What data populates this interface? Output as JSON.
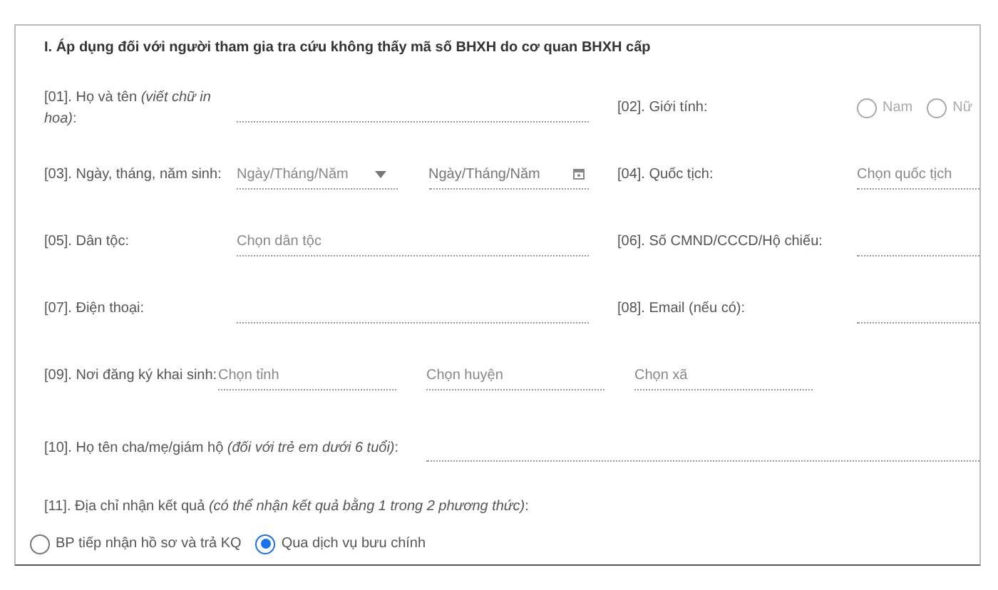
{
  "section_title": "I. Áp dụng đối với người tham gia tra cứu không thấy mã số BHXH do cơ quan BHXH cấp",
  "rows": [
    {
      "kind": "pair",
      "left": {
        "label": "[01]. Họ và tên *(viết chữ in hoa)*:",
        "control": {
          "kind": "text"
        }
      },
      "right": {
        "label": "[02]. Giới tính:",
        "control": {
          "kind": "radios",
          "options": [
            {
              "label": "Nam",
              "selected": false
            },
            {
              "label": "Nữ",
              "selected": false
            }
          ]
        }
      }
    },
    {
      "kind": "pair",
      "left": {
        "label": "[03]. Ngày, tháng, năm sinh:",
        "control": {
          "kind": "split",
          "controls": [
            {
              "kind": "select",
              "placeholder": "Ngày/Tháng/Năm",
              "caret": true
            },
            {
              "kind": "date",
              "placeholder": "Ngày/Tháng/Năm"
            }
          ]
        }
      },
      "right": {
        "label": "[04]. Quốc tịch:",
        "control": {
          "kind": "select",
          "placeholder": "Chọn quốc tịch",
          "caret": false
        }
      }
    },
    {
      "kind": "pair",
      "left": {
        "label": "[05]. Dân tộc:",
        "control": {
          "kind": "select",
          "placeholder": "Chọn dân tộc",
          "caret": false
        }
      },
      "right": {
        "label": "[06]. Số CMND/CCCD/Hộ chiếu:",
        "control": {
          "kind": "text"
        }
      }
    },
    {
      "kind": "pair",
      "left": {
        "label": "[07]. Điện thoại:",
        "control": {
          "kind": "text"
        }
      },
      "right": {
        "label": "[08]. Email (nếu có):",
        "control": {
          "kind": "text"
        }
      }
    },
    {
      "kind": "multi",
      "label": "[09]. Nơi đăng ký khai sinh:",
      "controls": [
        {
          "kind": "select",
          "placeholder": "Chọn tỉnh",
          "caret": false
        },
        {
          "kind": "select",
          "placeholder": "Chọn huyện",
          "caret": false
        },
        {
          "kind": "select",
          "placeholder": "Chọn xã",
          "caret": false
        }
      ]
    },
    {
      "kind": "wide",
      "label": "[10]. Họ tên cha/mẹ/giám hộ *(đối với trẻ em dưới 6 tuổi)*:",
      "control": {
        "kind": "text"
      }
    },
    {
      "kind": "radio",
      "label": "[11]. Địa chỉ nhận kết quả *(có thể nhận kết quả bằng 1 trong 2 phương thức)*:",
      "control": {
        "kind": "radios",
        "options": [
          {
            "label": "BP tiếp nhận hồ sơ và trả KQ",
            "selected": false
          },
          {
            "label": "Qua dịch vụ bưu chính",
            "selected": true
          }
        ]
      }
    }
  ]
}
